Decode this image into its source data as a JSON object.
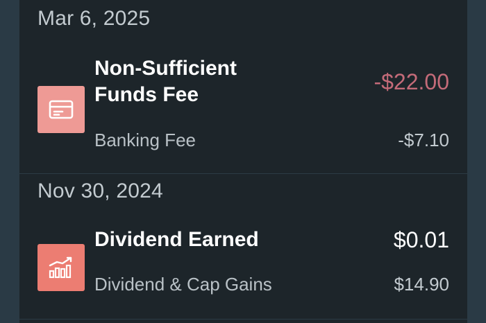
{
  "transactions": [
    {
      "date": "Mar 6, 2025",
      "title": "Non-Sufficient Funds Fee",
      "category": "Banking Fee",
      "amount": "-$22.00",
      "secondary_amount": "-$7.10",
      "icon": "credit-card-icon",
      "icon_color": "#ee9a95",
      "amount_color": "#c46b79"
    },
    {
      "date": "Nov 30, 2024",
      "title": "Dividend Earned",
      "category": "Dividend & Cap Gains",
      "amount": "$0.01",
      "secondary_amount": "$14.90",
      "icon": "bar-chart-growth-icon",
      "icon_color": "#ec7d72",
      "amount_color": "#ffffff"
    }
  ]
}
